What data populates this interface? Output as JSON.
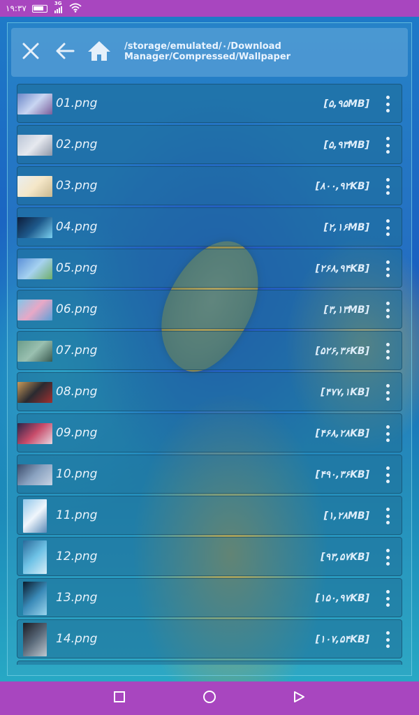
{
  "status": {
    "time": "۱۹:۳۷",
    "network": "3G",
    "colors": {
      "bar": "#a846bf"
    }
  },
  "toolbar": {
    "path": "/storage/emulated/۰/Download Manager/Compressed/Wallpaper",
    "icons": [
      "close-icon",
      "back-arrow-icon",
      "home-icon"
    ]
  },
  "files": [
    {
      "name": "01.png",
      "size": "[۵,۹۵MB]",
      "thumb": [
        "#6a86c8",
        "#c9d6f2",
        "#7a5e9a"
      ],
      "orientation": "landscape"
    },
    {
      "name": "02.png",
      "size": "[۵,۹۳MB]",
      "thumb": [
        "#b9c4d6",
        "#e6e9ef",
        "#8f97a8"
      ],
      "orientation": "landscape"
    },
    {
      "name": "03.png",
      "size": "[۸۰۰,۹۲KB]",
      "thumb": [
        "#e9eef0",
        "#f5e7c8",
        "#c9b890"
      ],
      "orientation": "landscape"
    },
    {
      "name": "04.png",
      "size": "[۲,۱۶MB]",
      "thumb": [
        "#0d1c3a",
        "#1e5a8c",
        "#7ad0f0"
      ],
      "orientation": "landscape"
    },
    {
      "name": "05.png",
      "size": "[۲۶۸,۹۴KB]",
      "thumb": [
        "#5a8fd8",
        "#a6d2f0",
        "#6fae6a"
      ],
      "orientation": "landscape"
    },
    {
      "name": "06.png",
      "size": "[۳,۱۳MB]",
      "thumb": [
        "#7fc6ea",
        "#e8a8c6",
        "#5aa0d8"
      ],
      "orientation": "landscape"
    },
    {
      "name": "07.png",
      "size": "[۵۲۶,۳۶KB]",
      "thumb": [
        "#6a9c8a",
        "#9ac0b0",
        "#3a5a50"
      ],
      "orientation": "landscape"
    },
    {
      "name": "08.png",
      "size": "[۴۷۷,۱KB]",
      "thumb": [
        "#c89a5a",
        "#2a2a30",
        "#a03030"
      ],
      "orientation": "landscape"
    },
    {
      "name": "09.png",
      "size": "[۴۶۸,۲۸KB]",
      "thumb": [
        "#2a2448",
        "#c84c6a",
        "#e8d6e0"
      ],
      "orientation": "landscape"
    },
    {
      "name": "10.png",
      "size": "[۴۹۰,۳۶KB]",
      "thumb": [
        "#3a4a6a",
        "#8aa2c0",
        "#c8d4e4"
      ],
      "orientation": "landscape"
    },
    {
      "name": "11.png",
      "size": "[۱,۲۸MB]",
      "thumb": [
        "#8ec6ea",
        "#f0f6fc",
        "#5a8ab8"
      ],
      "orientation": "portrait"
    },
    {
      "name": "12.png",
      "size": "[۹۳,۵۷KB]",
      "thumb": [
        "#2a6a9a",
        "#6ec2e6",
        "#d8eef8"
      ],
      "orientation": "portrait"
    },
    {
      "name": "13.png",
      "size": "[۱۵۰,۹۷KB]",
      "thumb": [
        "#0a1a2a",
        "#3a8ab8",
        "#9ad6ee"
      ],
      "orientation": "portrait"
    },
    {
      "name": "14.png",
      "size": "[۱۰۷,۵۴KB]",
      "thumb": [
        "#1a1a22",
        "#5a6a7a",
        "#c0c8d0"
      ],
      "orientation": "portrait"
    },
    {
      "name": "",
      "size": "",
      "thumb": [
        "#d89a3a",
        "#e8c070",
        "#8a5a2a"
      ],
      "orientation": "landscape"
    }
  ],
  "nav": {
    "icons": [
      "recents-square-icon",
      "home-circle-icon",
      "back-triangle-icon"
    ]
  }
}
